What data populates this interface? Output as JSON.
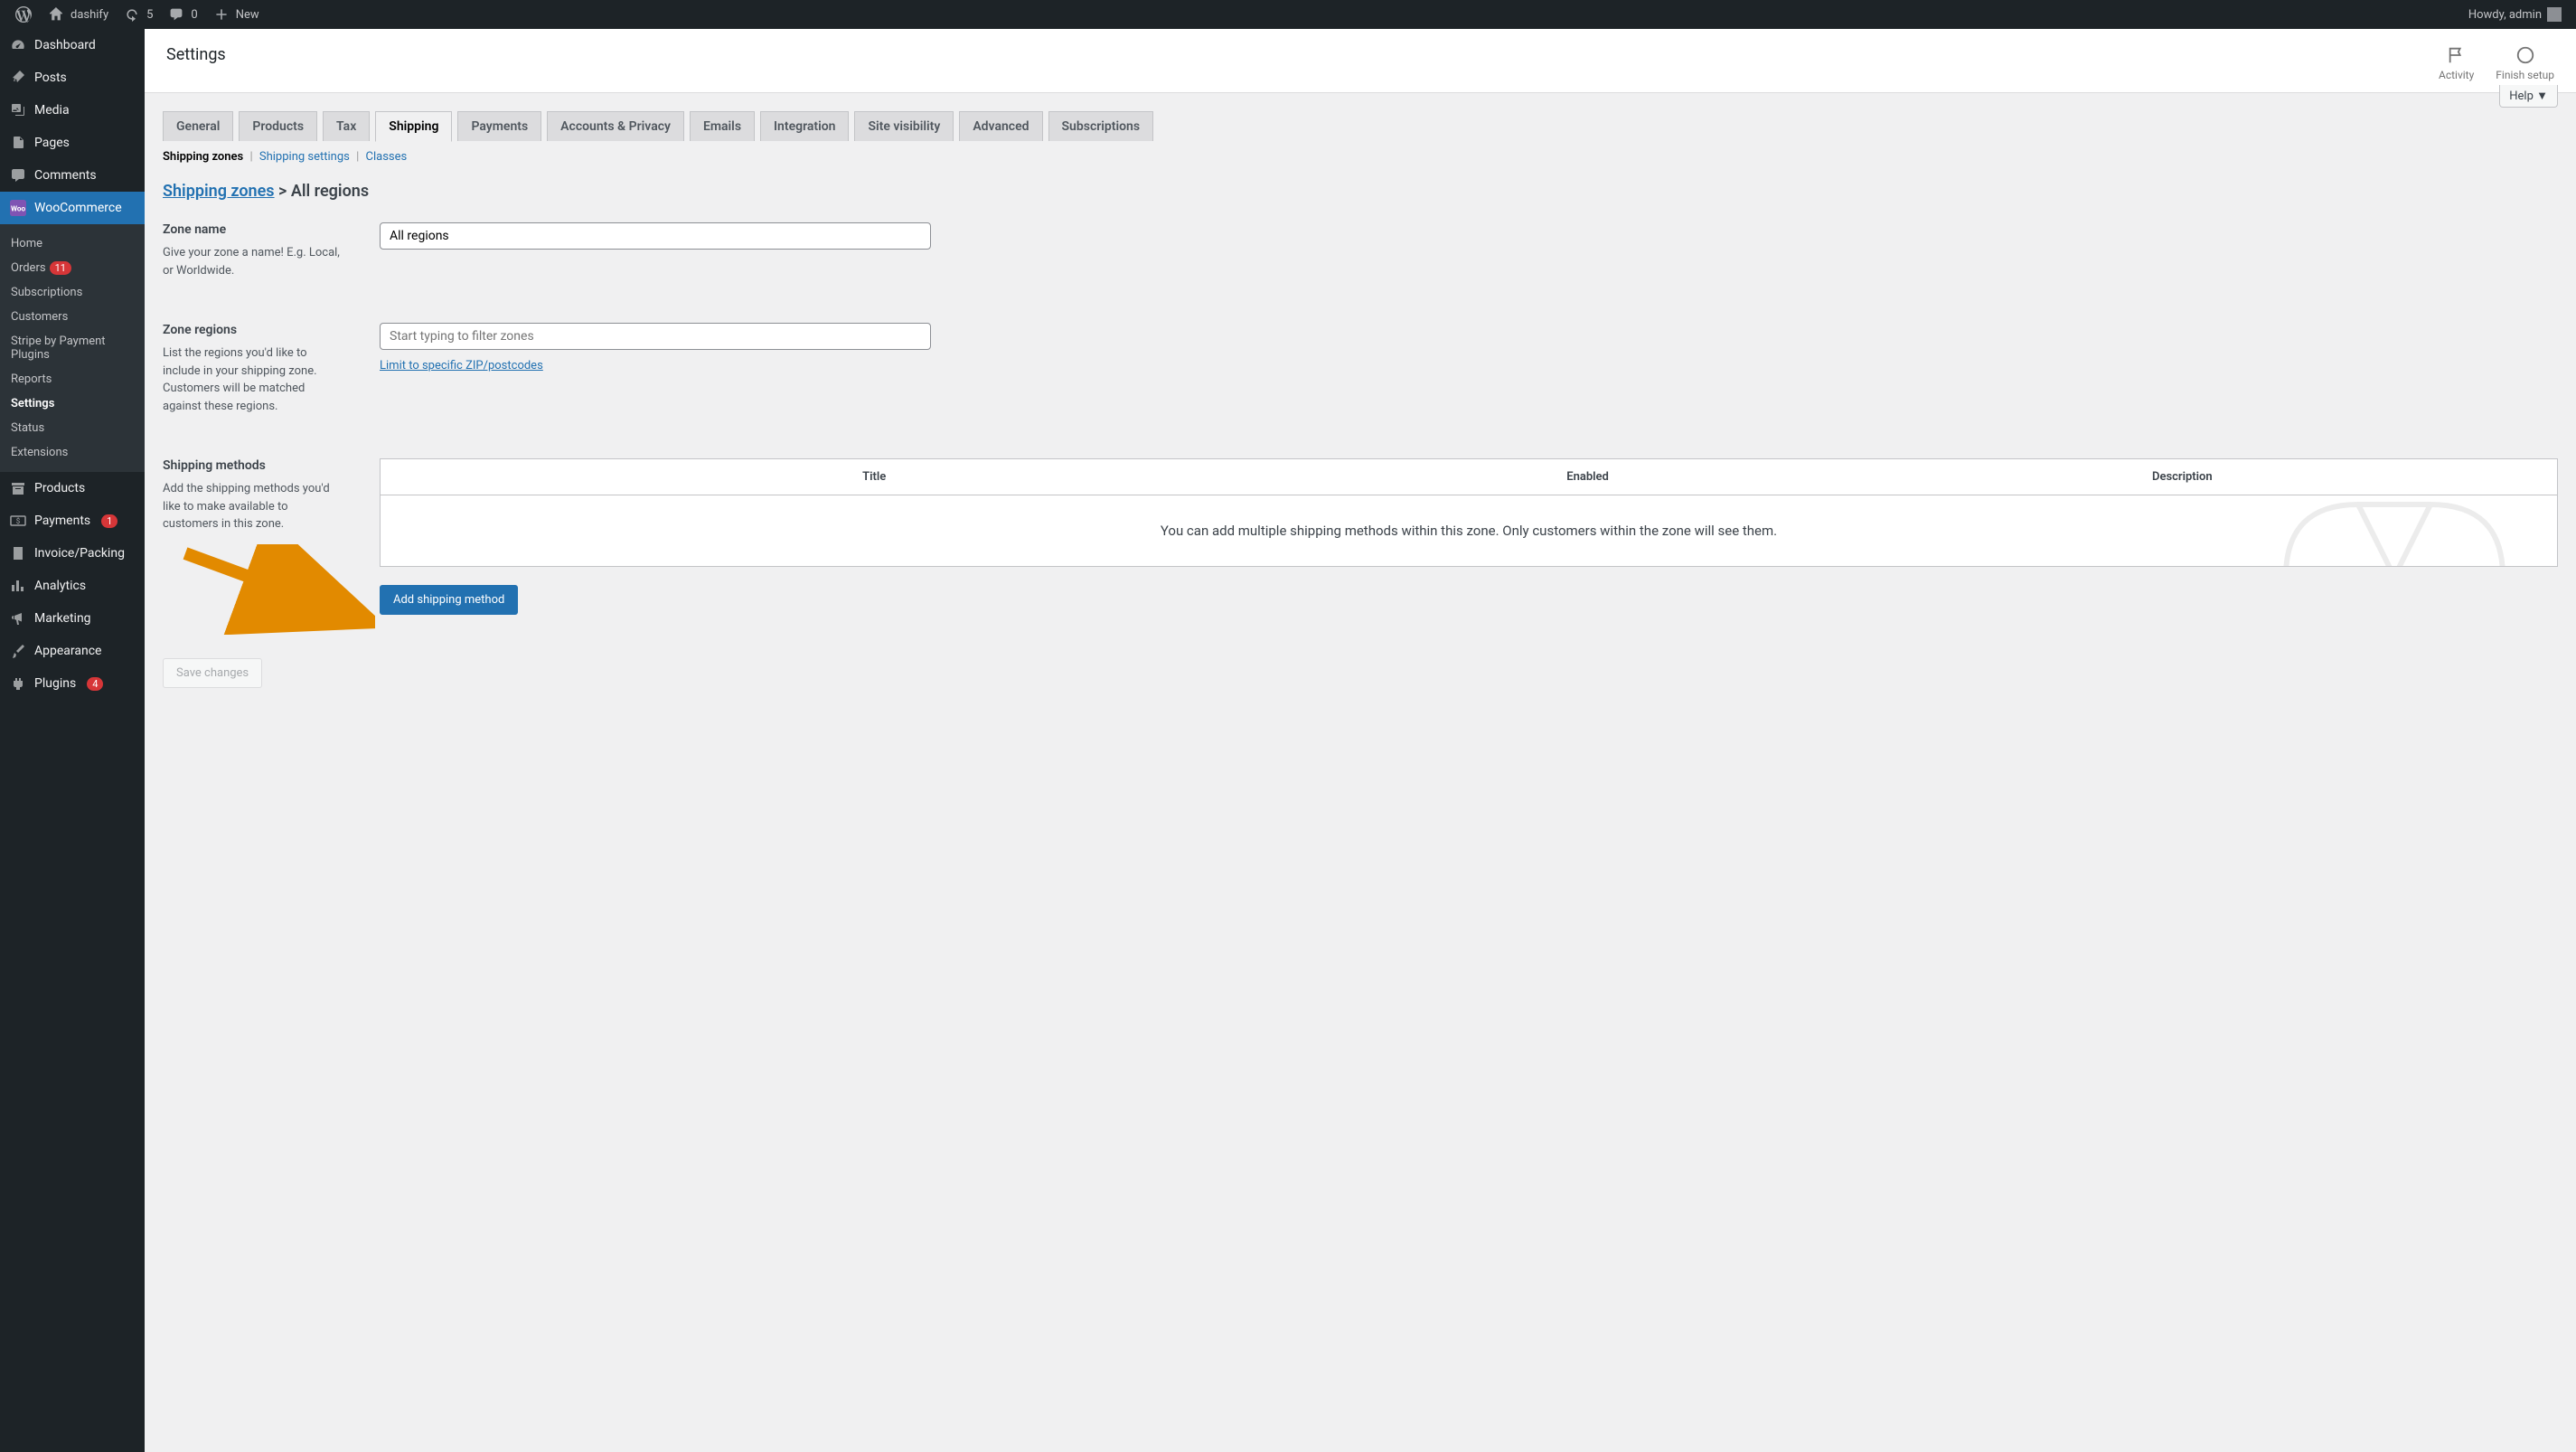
{
  "adminbar": {
    "site_name": "dashify",
    "updates": "5",
    "comments": "0",
    "new": "New",
    "howdy": "Howdy, admin"
  },
  "sidebar": {
    "dashboard": "Dashboard",
    "posts": "Posts",
    "media": "Media",
    "pages": "Pages",
    "comments": "Comments",
    "woocommerce": "WooCommerce",
    "products": "Products",
    "payments": "Payments",
    "payments_badge": "1",
    "invoice": "Invoice/Packing",
    "analytics": "Analytics",
    "marketing": "Marketing",
    "appearance": "Appearance",
    "plugins": "Plugins",
    "plugins_badge": "4",
    "woo_sub": {
      "home": "Home",
      "orders": "Orders",
      "orders_badge": "11",
      "subscriptions": "Subscriptions",
      "customers": "Customers",
      "stripe": "Stripe by Payment Plugins",
      "reports": "Reports",
      "settings": "Settings",
      "status": "Status",
      "extensions": "Extensions"
    }
  },
  "header": {
    "title": "Settings",
    "activity": "Activity",
    "finish": "Finish setup",
    "help": "Help"
  },
  "tabs": {
    "general": "General",
    "products": "Products",
    "tax": "Tax",
    "shipping": "Shipping",
    "payments": "Payments",
    "accounts": "Accounts & Privacy",
    "emails": "Emails",
    "integration": "Integration",
    "site_visibility": "Site visibility",
    "advanced": "Advanced",
    "subscriptions": "Subscriptions"
  },
  "subnav": {
    "zones": "Shipping zones",
    "settings": "Shipping settings",
    "classes": "Classes"
  },
  "breadcrumb": {
    "root": "Shipping zones",
    "sep": " > ",
    "current": "All regions"
  },
  "zone_name": {
    "label": "Zone name",
    "help": "Give your zone a name! E.g. Local, or Worldwide.",
    "value": "All regions"
  },
  "zone_regions": {
    "label": "Zone regions",
    "help": "List the regions you'd like to include in your shipping zone. Customers will be matched against these regions.",
    "placeholder": "Start typing to filter zones",
    "link": "Limit to specific ZIP/postcodes"
  },
  "shipping_methods": {
    "label": "Shipping methods",
    "help": "Add the shipping methods you'd like to make available to customers in this zone.",
    "col_title": "Title",
    "col_enabled": "Enabled",
    "col_desc": "Description",
    "empty": "You can add multiple shipping methods within this zone. Only customers within the zone will see them.",
    "add_button": "Add shipping method"
  },
  "save_button": "Save changes"
}
